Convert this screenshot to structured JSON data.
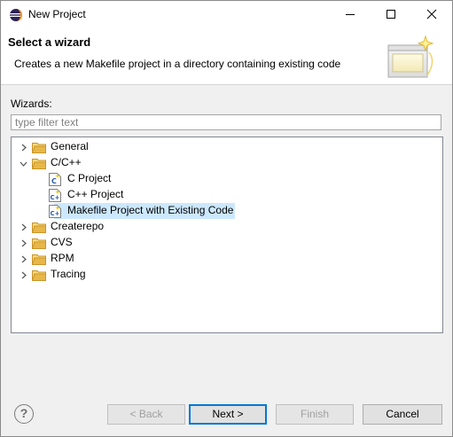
{
  "window": {
    "title": "New Project"
  },
  "header": {
    "title": "Select a wizard",
    "description": "Creates a new Makefile project in a directory containing existing code"
  },
  "wizards_label": "Wizards:",
  "filter": {
    "placeholder": "type filter text",
    "value": ""
  },
  "tree": {
    "items": [
      {
        "label": "General",
        "expanded": false,
        "type": "folder"
      },
      {
        "label": "C/C++",
        "expanded": true,
        "type": "folder"
      },
      {
        "label": "C Project",
        "type": "c-project"
      },
      {
        "label": "C++ Project",
        "type": "cpp-project"
      },
      {
        "label": "Makefile Project with Existing Code",
        "type": "cpp-project",
        "selected": true
      },
      {
        "label": "Createrepo",
        "expanded": false,
        "type": "folder"
      },
      {
        "label": "CVS",
        "expanded": false,
        "type": "folder"
      },
      {
        "label": "RPM",
        "expanded": false,
        "type": "folder"
      },
      {
        "label": "Tracing",
        "expanded": false,
        "type": "folder"
      }
    ]
  },
  "buttons": {
    "back": "< Back",
    "next": "Next >",
    "finish": "Finish",
    "cancel": "Cancel",
    "help": "?"
  },
  "colors": {
    "selection": "#cce8ff",
    "folder": "#e8b74a",
    "default_button_border": "#0078d7"
  },
  "icons": {
    "app": "eclipse-icon",
    "wizard_banner": "new-project-wizard-icon",
    "folder": "folder-icon",
    "c_file": "c-file-icon",
    "cpp_file": "cpp-file-icon"
  }
}
